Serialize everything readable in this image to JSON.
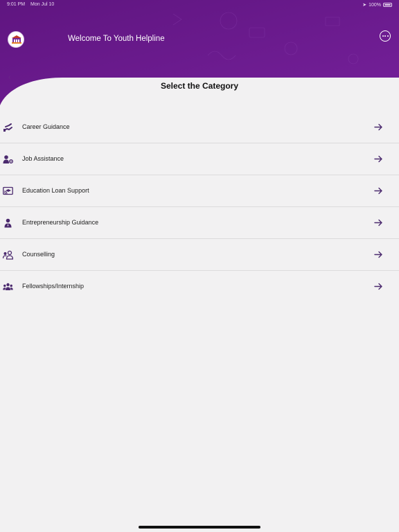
{
  "colors": {
    "header": "#6d1a8e",
    "accent": "#4b2a6e",
    "background": "#f2f1f2"
  },
  "status_bar": {
    "time": "9:01 PM",
    "date": "Mon Jul 10",
    "battery": "100%"
  },
  "header": {
    "welcome": "Welcome To Youth Helpline",
    "logo_icon": "youth-helpline-logo",
    "menu_icon": "more-options-icon"
  },
  "page_title": "Select the Category",
  "categories": [
    {
      "label": "Career Guidance",
      "icon": "career-guidance-icon"
    },
    {
      "label": "Job Assistance",
      "icon": "job-assistance-icon"
    },
    {
      "label": "Education Loan Support",
      "icon": "education-loan-icon"
    },
    {
      "label": "Entrepreneurship Guidance",
      "icon": "entrepreneurship-icon"
    },
    {
      "label": "Counselling",
      "icon": "counselling-icon"
    },
    {
      "label": "Fellowships/Internship",
      "icon": "fellowships-icon"
    }
  ]
}
